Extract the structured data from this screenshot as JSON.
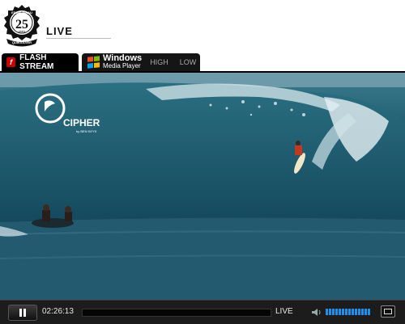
{
  "header": {
    "logo": {
      "icon": "event-badge-icon",
      "top_text": "EDDIE AIKAU",
      "number": "25",
      "sub_text": "years",
      "bottom_text": "QUIKSILVER"
    },
    "title": "LIVE"
  },
  "tabs": {
    "flash": {
      "icon": "flash-icon",
      "label": "FLASH STREAM"
    },
    "wmp": {
      "icon": "windows-logo-icon",
      "line1": "Windows",
      "line2": "Media Player",
      "qualities": [
        "HIGH",
        "LOW"
      ]
    }
  },
  "video": {
    "watermark_brand": "CIPHER",
    "watermark_sub": "by BEN KEYS"
  },
  "controls": {
    "play_icon": "pause-icon",
    "time": "02:26:13",
    "live_label": "LIVE",
    "volume_icon": "speaker-icon",
    "volume_level": 1.0,
    "fullscreen_icon": "fullscreen-icon"
  },
  "colors": {
    "flash_red": "#cc0000",
    "volume_blue": "#1e90e8",
    "win_red": "#f25022",
    "win_green": "#7fba00",
    "win_blue": "#00a4ef",
    "win_yellow": "#ffb900"
  }
}
